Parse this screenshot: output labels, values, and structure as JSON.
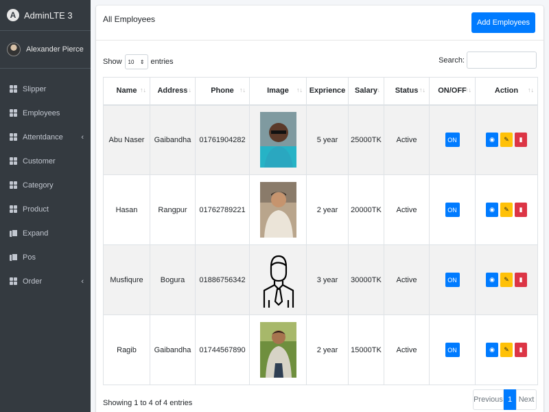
{
  "brand": {
    "logo_letter": "A",
    "name": "AdminLTE 3"
  },
  "user": {
    "name": "Alexander Pierce"
  },
  "sidebar": {
    "items": [
      {
        "label": "Slipper",
        "icon": "grid-icon",
        "chevron": ""
      },
      {
        "label": "Employees",
        "icon": "grid-icon",
        "chevron": ""
      },
      {
        "label": "Attentdance",
        "icon": "grid-icon",
        "chevron": "‹"
      },
      {
        "label": "Customer",
        "icon": "grid-icon",
        "chevron": ""
      },
      {
        "label": "Category",
        "icon": "grid-icon",
        "chevron": ""
      },
      {
        "label": "Product",
        "icon": "grid-icon",
        "chevron": ""
      },
      {
        "label": "Expand",
        "icon": "copy-icon",
        "chevron": ""
      },
      {
        "label": "Pos",
        "icon": "copy-icon",
        "chevron": ""
      },
      {
        "label": "Order",
        "icon": "grid-icon",
        "chevron": "‹"
      }
    ]
  },
  "card": {
    "title": "All Employees",
    "add_button": "Add Employees"
  },
  "controls": {
    "show_label": "Show",
    "entries_value": "10",
    "entries_label": "entries",
    "search_label": "Search:",
    "search_value": ""
  },
  "table": {
    "headers": [
      "Name",
      "Address",
      "Phone",
      "Image",
      "Exprience",
      "Salary",
      "Status",
      "ON/OFF",
      "Action"
    ],
    "rows": [
      {
        "name": "Abu Naser",
        "address": "Gaibandha",
        "phone": "01761904282",
        "image": "photo-blue-shirt",
        "experience": "5 year",
        "salary": "25000TK",
        "status": "Active",
        "toggle": "ON"
      },
      {
        "name": "Hasan",
        "address": "Rangpur",
        "phone": "01762789221",
        "image": "photo-white-shirt",
        "experience": "2 year",
        "salary": "20000TK",
        "status": "Active",
        "toggle": "ON"
      },
      {
        "name": "Musfiqure",
        "address": "Bogura",
        "phone": "01886756342",
        "image": "businessman-icon",
        "experience": "3 year",
        "salary": "30000TK",
        "status": "Active",
        "toggle": "ON"
      },
      {
        "name": "Ragib",
        "address": "Gaibandha",
        "phone": "01744567890",
        "image": "photo-check-shirt",
        "experience": "2 year",
        "salary": "15000TK",
        "status": "Active",
        "toggle": "ON"
      }
    ]
  },
  "footer": {
    "info": "Showing 1 to 4 of 4 entries",
    "previous": "Previous",
    "page": "1",
    "next": "Next"
  },
  "colors": {
    "sidebar": "#343a40",
    "primary": "#007bff",
    "warning": "#ffc107",
    "danger": "#dc3545"
  }
}
